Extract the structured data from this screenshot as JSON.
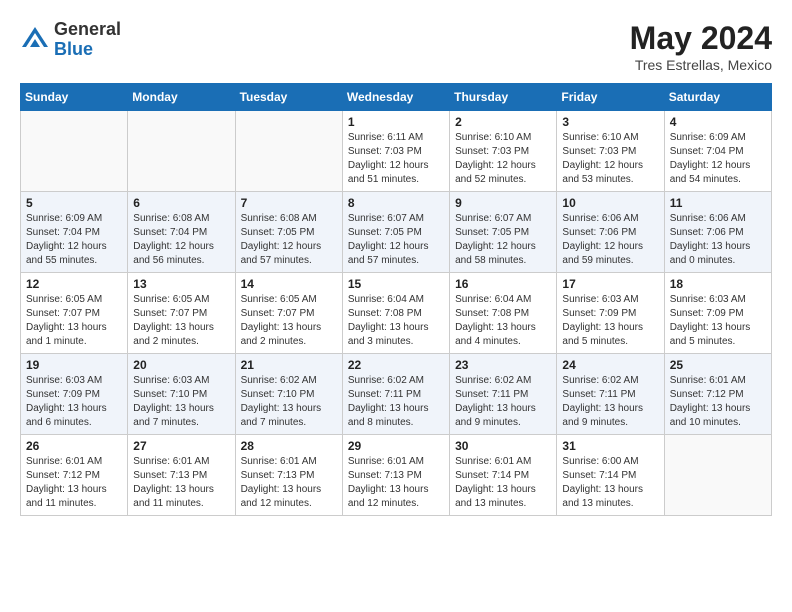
{
  "header": {
    "logo_general": "General",
    "logo_blue": "Blue",
    "month_title": "May 2024",
    "location": "Tres Estrellas, Mexico"
  },
  "weekdays": [
    "Sunday",
    "Monday",
    "Tuesday",
    "Wednesday",
    "Thursday",
    "Friday",
    "Saturday"
  ],
  "weeks": [
    [
      {
        "day": "",
        "info": ""
      },
      {
        "day": "",
        "info": ""
      },
      {
        "day": "",
        "info": ""
      },
      {
        "day": "1",
        "info": "Sunrise: 6:11 AM\nSunset: 7:03 PM\nDaylight: 12 hours\nand 51 minutes."
      },
      {
        "day": "2",
        "info": "Sunrise: 6:10 AM\nSunset: 7:03 PM\nDaylight: 12 hours\nand 52 minutes."
      },
      {
        "day": "3",
        "info": "Sunrise: 6:10 AM\nSunset: 7:03 PM\nDaylight: 12 hours\nand 53 minutes."
      },
      {
        "day": "4",
        "info": "Sunrise: 6:09 AM\nSunset: 7:04 PM\nDaylight: 12 hours\nand 54 minutes."
      }
    ],
    [
      {
        "day": "5",
        "info": "Sunrise: 6:09 AM\nSunset: 7:04 PM\nDaylight: 12 hours\nand 55 minutes."
      },
      {
        "day": "6",
        "info": "Sunrise: 6:08 AM\nSunset: 7:04 PM\nDaylight: 12 hours\nand 56 minutes."
      },
      {
        "day": "7",
        "info": "Sunrise: 6:08 AM\nSunset: 7:05 PM\nDaylight: 12 hours\nand 57 minutes."
      },
      {
        "day": "8",
        "info": "Sunrise: 6:07 AM\nSunset: 7:05 PM\nDaylight: 12 hours\nand 57 minutes."
      },
      {
        "day": "9",
        "info": "Sunrise: 6:07 AM\nSunset: 7:05 PM\nDaylight: 12 hours\nand 58 minutes."
      },
      {
        "day": "10",
        "info": "Sunrise: 6:06 AM\nSunset: 7:06 PM\nDaylight: 12 hours\nand 59 minutes."
      },
      {
        "day": "11",
        "info": "Sunrise: 6:06 AM\nSunset: 7:06 PM\nDaylight: 13 hours\nand 0 minutes."
      }
    ],
    [
      {
        "day": "12",
        "info": "Sunrise: 6:05 AM\nSunset: 7:07 PM\nDaylight: 13 hours\nand 1 minute."
      },
      {
        "day": "13",
        "info": "Sunrise: 6:05 AM\nSunset: 7:07 PM\nDaylight: 13 hours\nand 2 minutes."
      },
      {
        "day": "14",
        "info": "Sunrise: 6:05 AM\nSunset: 7:07 PM\nDaylight: 13 hours\nand 2 minutes."
      },
      {
        "day": "15",
        "info": "Sunrise: 6:04 AM\nSunset: 7:08 PM\nDaylight: 13 hours\nand 3 minutes."
      },
      {
        "day": "16",
        "info": "Sunrise: 6:04 AM\nSunset: 7:08 PM\nDaylight: 13 hours\nand 4 minutes."
      },
      {
        "day": "17",
        "info": "Sunrise: 6:03 AM\nSunset: 7:09 PM\nDaylight: 13 hours\nand 5 minutes."
      },
      {
        "day": "18",
        "info": "Sunrise: 6:03 AM\nSunset: 7:09 PM\nDaylight: 13 hours\nand 5 minutes."
      }
    ],
    [
      {
        "day": "19",
        "info": "Sunrise: 6:03 AM\nSunset: 7:09 PM\nDaylight: 13 hours\nand 6 minutes."
      },
      {
        "day": "20",
        "info": "Sunrise: 6:03 AM\nSunset: 7:10 PM\nDaylight: 13 hours\nand 7 minutes."
      },
      {
        "day": "21",
        "info": "Sunrise: 6:02 AM\nSunset: 7:10 PM\nDaylight: 13 hours\nand 7 minutes."
      },
      {
        "day": "22",
        "info": "Sunrise: 6:02 AM\nSunset: 7:11 PM\nDaylight: 13 hours\nand 8 minutes."
      },
      {
        "day": "23",
        "info": "Sunrise: 6:02 AM\nSunset: 7:11 PM\nDaylight: 13 hours\nand 9 minutes."
      },
      {
        "day": "24",
        "info": "Sunrise: 6:02 AM\nSunset: 7:11 PM\nDaylight: 13 hours\nand 9 minutes."
      },
      {
        "day": "25",
        "info": "Sunrise: 6:01 AM\nSunset: 7:12 PM\nDaylight: 13 hours\nand 10 minutes."
      }
    ],
    [
      {
        "day": "26",
        "info": "Sunrise: 6:01 AM\nSunset: 7:12 PM\nDaylight: 13 hours\nand 11 minutes."
      },
      {
        "day": "27",
        "info": "Sunrise: 6:01 AM\nSunset: 7:13 PM\nDaylight: 13 hours\nand 11 minutes."
      },
      {
        "day": "28",
        "info": "Sunrise: 6:01 AM\nSunset: 7:13 PM\nDaylight: 13 hours\nand 12 minutes."
      },
      {
        "day": "29",
        "info": "Sunrise: 6:01 AM\nSunset: 7:13 PM\nDaylight: 13 hours\nand 12 minutes."
      },
      {
        "day": "30",
        "info": "Sunrise: 6:01 AM\nSunset: 7:14 PM\nDaylight: 13 hours\nand 13 minutes."
      },
      {
        "day": "31",
        "info": "Sunrise: 6:00 AM\nSunset: 7:14 PM\nDaylight: 13 hours\nand 13 minutes."
      },
      {
        "day": "",
        "info": ""
      }
    ]
  ]
}
